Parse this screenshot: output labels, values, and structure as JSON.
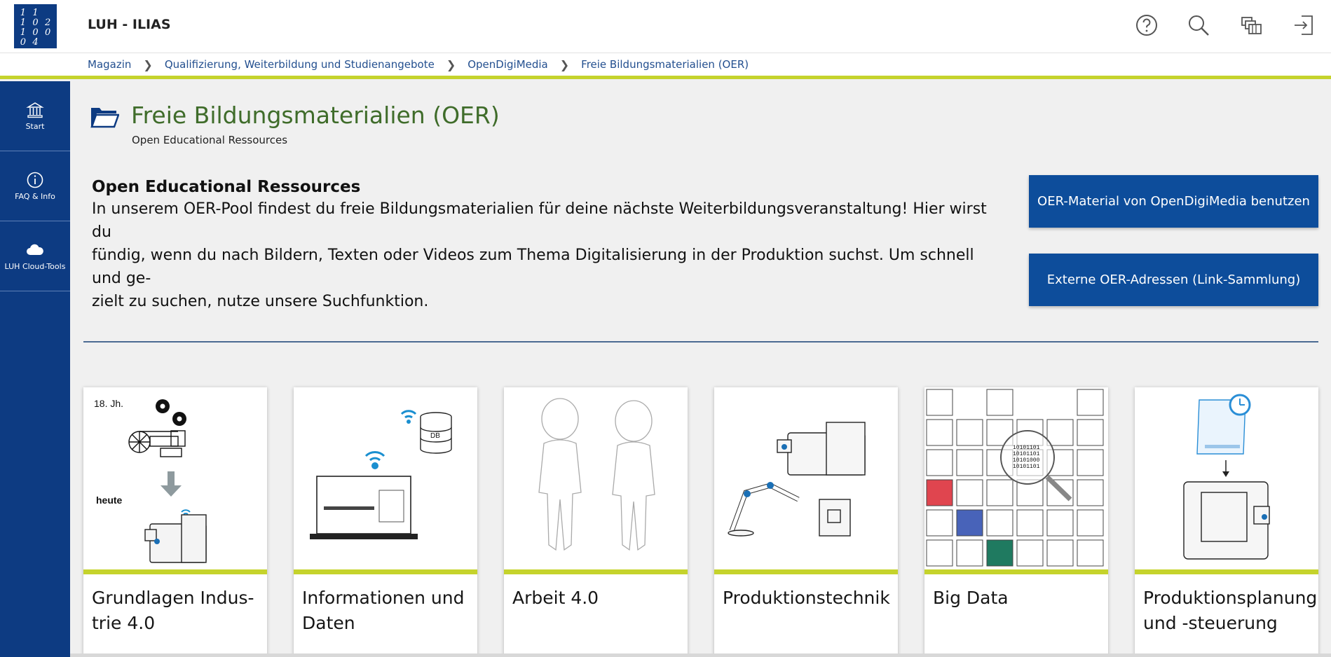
{
  "header": {
    "logo_text": [
      "1",
      "1",
      "",
      "1",
      "0",
      "2",
      "1",
      "0",
      "0",
      "0",
      "4",
      ""
    ],
    "app_title": "LUH - ILIAS",
    "icons": [
      "help-icon",
      "search-icon",
      "notification-center-icon",
      "logout-icon"
    ]
  },
  "breadcrumb": {
    "items": [
      "Magazin",
      "Qualifizierung, Weiterbildung und Studienangebote",
      "OpenDigiMedia",
      "Freie Bildungsmaterialien (OER)"
    ]
  },
  "sidebar": {
    "items": [
      {
        "label": "Start",
        "icon": "building-icon"
      },
      {
        "label": "FAQ & Info",
        "icon": "info-icon"
      },
      {
        "label": "LUH Cloud-Tools",
        "icon": "cloud-icon"
      }
    ]
  },
  "main": {
    "title": "Freie Bildungsmaterialien (OER)",
    "subtitle": "Open Educational Ressources",
    "intro_heading": "Open Educational Ressources",
    "intro_lines": [
      "In unserem OER-Pool findest du freie Bildungsmaterialien für deine nächste Weiterbildungsveranstaltung! Hier wirst du",
      "fündig, wenn du nach Bildern, Texten oder Videos zum Thema Digitalisierung in der Produktion suchst. Um schnell und ge-",
      "zielt zu suchen, nutze unsere Suchfunktion."
    ],
    "buttons": [
      "OER-Material von OpenDigiMedia benutzen",
      "Externe OER-Adressen (Link-Sammlung)"
    ],
    "tiles": [
      {
        "label": "Grundlagen Indus-trie 4.0",
        "img_text": [
          "18. Jh.",
          "heute"
        ]
      },
      {
        "label": "Informationen und Daten",
        "img_text": [
          "DB"
        ]
      },
      {
        "label": "Arbeit 4.0",
        "img_text": []
      },
      {
        "label": "Produktionstechnik",
        "img_text": []
      },
      {
        "label": "Big Data",
        "img_text": [
          "10101101",
          "10101101",
          "10101000",
          "10101101"
        ]
      },
      {
        "label": "Produktionsplanung und -steuerung",
        "img_text": []
      }
    ]
  },
  "colors": {
    "brand_blue": "#0d3b82",
    "accent_green": "#c5d32c",
    "title_green": "#3f6c2a",
    "button_blue": "#0d4d9b"
  }
}
